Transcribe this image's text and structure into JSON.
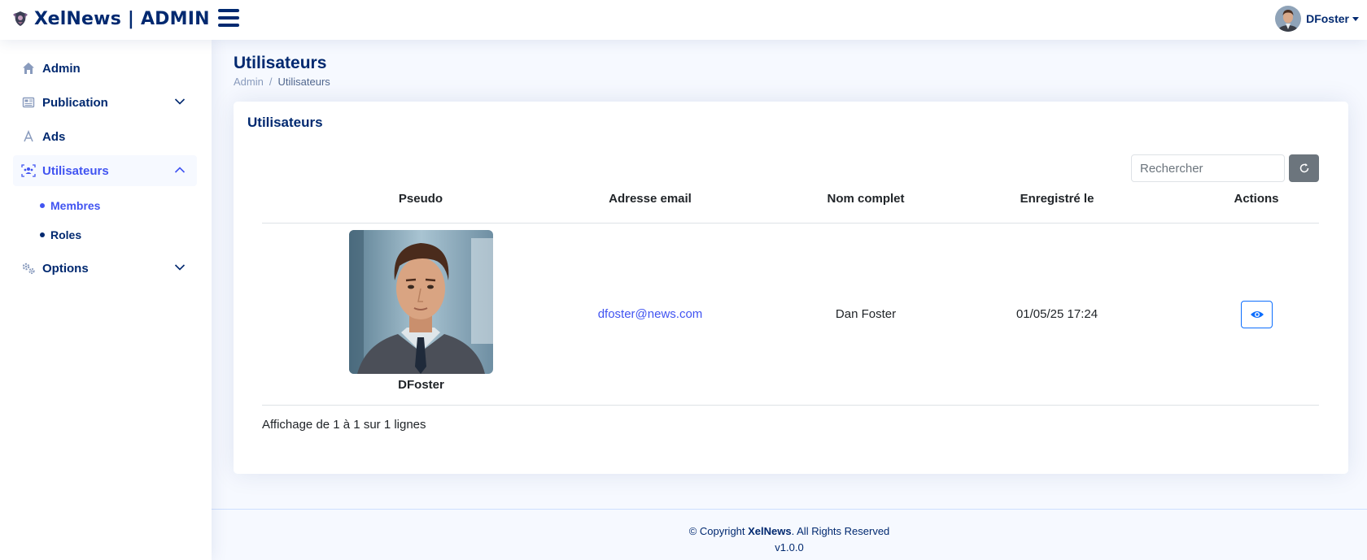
{
  "header": {
    "brand": "XelNews | ADMIN",
    "logo_icon": "shield-crest-icon",
    "menu_icon": "hamburger-icon",
    "user_name": "DFoster"
  },
  "sidebar": {
    "items": [
      {
        "label": "Admin",
        "icon": "home-icon"
      },
      {
        "label": "Publication",
        "icon": "newspaper-icon",
        "expandable": true
      },
      {
        "label": "Ads",
        "icon": "ads-icon"
      },
      {
        "label": "Utilisateurs",
        "icon": "users-icon",
        "expandable": true,
        "expanded": true,
        "active": true
      },
      {
        "label": "Options",
        "icon": "gears-icon",
        "expandable": true
      }
    ],
    "subitems": [
      {
        "label": "Membres",
        "active": true
      },
      {
        "label": "Roles",
        "active": false
      }
    ]
  },
  "page": {
    "title": "Utilisateurs",
    "breadcrumb": [
      "Admin",
      "Utilisateurs"
    ]
  },
  "card": {
    "title": "Utilisateurs",
    "search_placeholder": "Rechercher",
    "columns": [
      "Pseudo",
      "Adresse email",
      "Nom complet",
      "Enregistré le",
      "Actions"
    ],
    "rows": [
      {
        "pseudo": "DFoster",
        "email": "dfoster@news.com",
        "full_name": "Dan Foster",
        "registered": "01/05/25 17:24",
        "action_icon": "eye-icon"
      }
    ],
    "info": "Affichage de 1 à 1 sur 1 lignes"
  },
  "footer": {
    "copyright_prefix": "© Copyright ",
    "copyright_brand": "XelNews",
    "copyright_suffix": ". All Rights Reserved",
    "version": "v1.0.0"
  },
  "colors": {
    "primary": "#4154f1",
    "navy": "#012970",
    "page_bg": "#f6f9ff",
    "refresh_button": "#6c757d"
  }
}
